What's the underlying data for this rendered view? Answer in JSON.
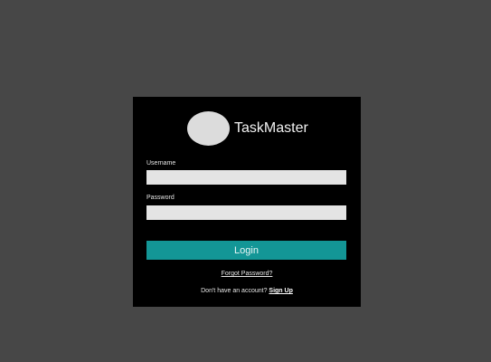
{
  "app": {
    "title": "TaskMaster"
  },
  "form": {
    "username_label": "Username",
    "username_value": "",
    "password_label": "Password",
    "password_value": "",
    "login_label": "Login",
    "forgot_label": "Forgot Password?",
    "signup_prompt": "Don't have an account?",
    "signup_label": "Sign Up"
  },
  "colors": {
    "background": "#474747",
    "card": "#000000",
    "accent": "#139696",
    "input": "#e4e4e4",
    "logo": "#dcdcdc"
  },
  "icons": {
    "logo": "logo-circle"
  }
}
